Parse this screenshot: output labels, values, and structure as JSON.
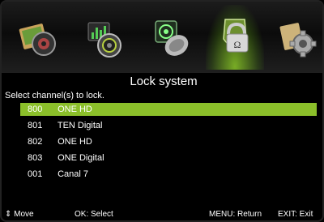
{
  "menu": {
    "icons": [
      "picture-icon",
      "sound-icon",
      "channel-icon",
      "lock-icon",
      "settings-icon"
    ],
    "active_index": 3
  },
  "screen": {
    "title": "Lock system",
    "instruction": "Select channel(s) to lock."
  },
  "channels": [
    {
      "number": "800",
      "name": "ONE HD"
    },
    {
      "number": "801",
      "name": "TEN Digital"
    },
    {
      "number": "802",
      "name": "ONE HD"
    },
    {
      "number": "803",
      "name": "ONE Digital"
    },
    {
      "number": "001",
      "name": "Canal 7"
    }
  ],
  "selected_channel_index": 0,
  "footer": {
    "move_label": "⇕ Move",
    "select_label": "OK: Select",
    "return_label": "MENU: Return",
    "exit_label": "EXIT: Exit"
  },
  "colors": {
    "highlight": "#8bbf2a",
    "background": "#000000"
  }
}
